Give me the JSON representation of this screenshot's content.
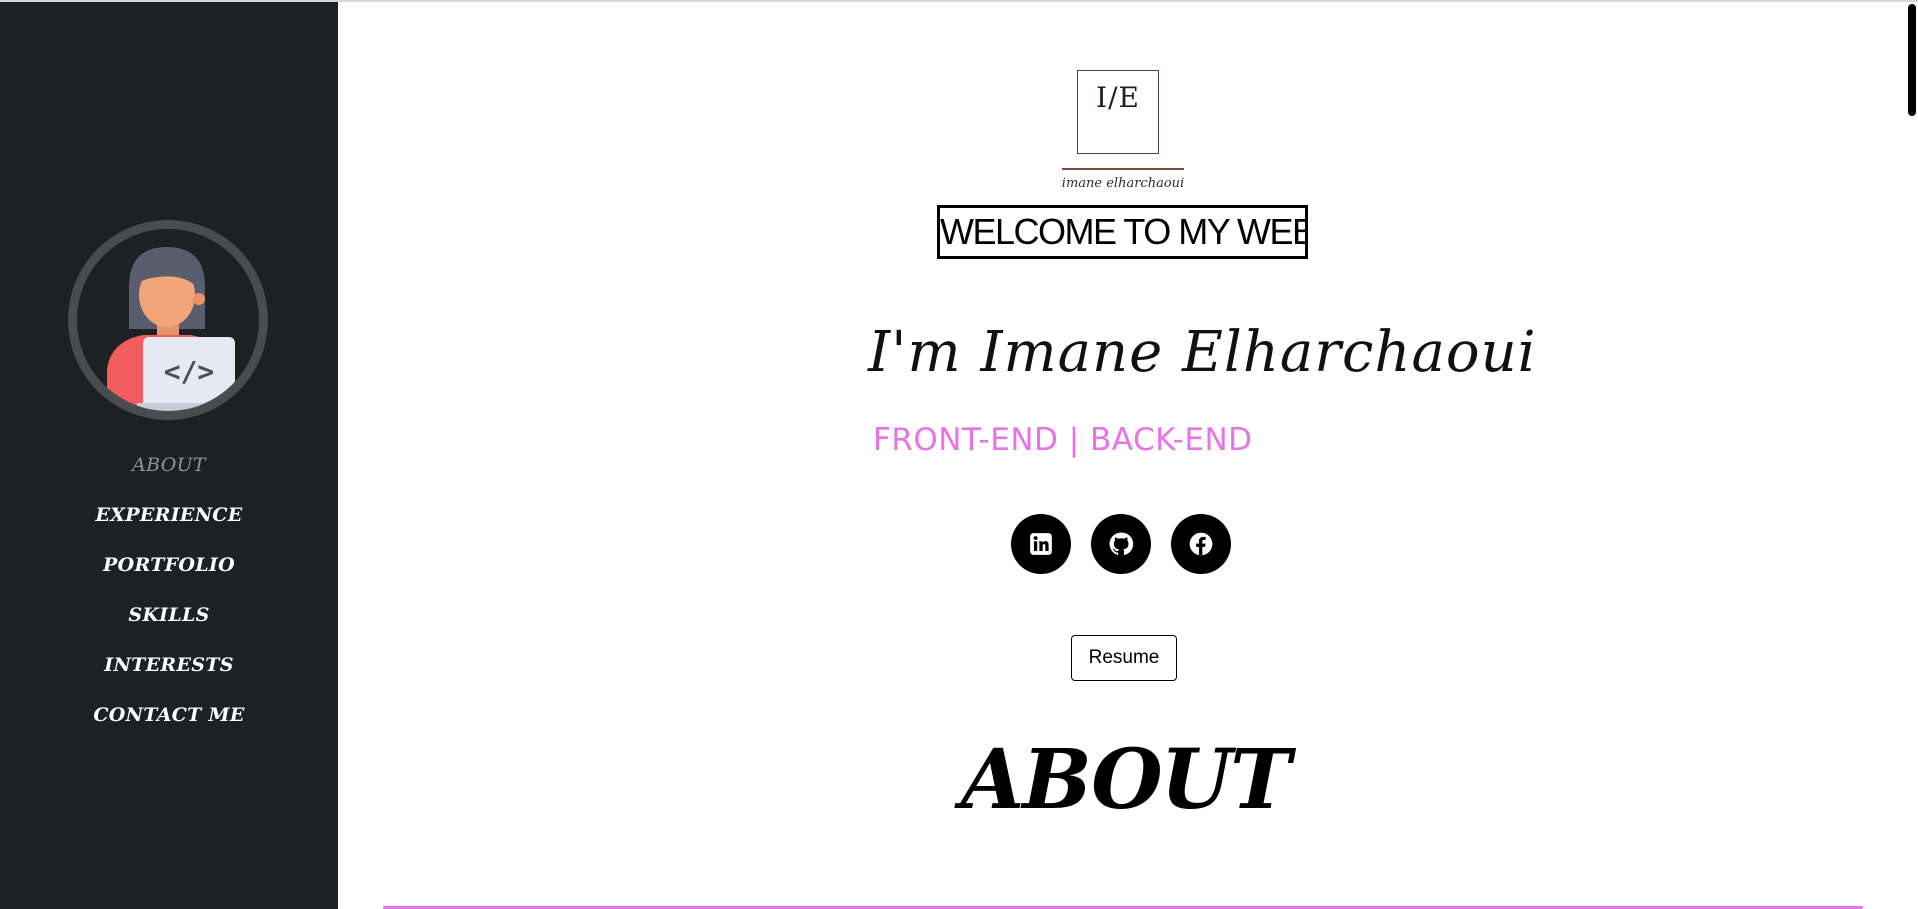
{
  "sidebar": {
    "avatar_icon": "developer-avatar-icon",
    "items": [
      {
        "label": "ABOUT",
        "active": true
      },
      {
        "label": "EXPERIENCE",
        "active": false
      },
      {
        "label": "PORTFOLIO",
        "active": false
      },
      {
        "label": "SKILLS",
        "active": false
      },
      {
        "label": "INTERESTS",
        "active": false
      },
      {
        "label": "CONTACT ME",
        "active": false
      }
    ]
  },
  "logo": {
    "mark": "I/E",
    "name": "imane elharchaoui"
  },
  "hero": {
    "welcome": "WELCOME TO MY WEBSITE !",
    "greeting": "I'm Imane Elharchaoui",
    "role": "FRONT-END | BACK-END",
    "social": [
      {
        "icon": "linkedin-icon",
        "name": "linkedin"
      },
      {
        "icon": "github-icon",
        "name": "github"
      },
      {
        "icon": "facebook-icon",
        "name": "facebook"
      }
    ],
    "resume_label": "Resume"
  },
  "about": {
    "heading": "ABOUT"
  },
  "colors": {
    "sidebar_bg": "#1e2124",
    "accent_pink": "#e872e8",
    "logo_brown": "#6b3a35"
  }
}
